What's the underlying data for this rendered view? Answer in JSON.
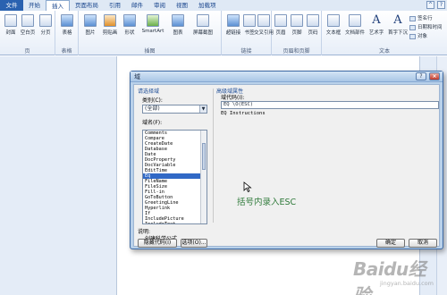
{
  "ribbon_tabs": [
    "文件",
    "开始",
    "插入",
    "页面布局",
    "引用",
    "邮件",
    "审阅",
    "视图",
    "加载项"
  ],
  "window_buttons": [
    "^",
    "?"
  ],
  "ribbon": {
    "pages_group": {
      "label": "页",
      "buttons": [
        "封面",
        "空白页",
        "分页"
      ]
    },
    "table_group": {
      "label": "表格",
      "buttons": [
        "表格"
      ]
    },
    "illustration_group": {
      "label": "插图",
      "buttons": [
        "图片",
        "剪贴画",
        "形状",
        "SmartArt",
        "图表",
        "屏幕截图"
      ]
    },
    "links_group": {
      "label": "链接",
      "buttons": [
        "超链接",
        "书签",
        "交叉引用"
      ]
    },
    "header_group": {
      "label": "页眉和页脚",
      "buttons": [
        "页眉",
        "页脚",
        "页码"
      ]
    },
    "text_group": {
      "label": "文本",
      "buttons": [
        "文本框",
        "文档部件",
        "艺术字",
        "首字下沉"
      ],
      "small_buttons": [
        "签名行",
        "日期和时间",
        "对象"
      ]
    }
  },
  "dialog": {
    "title": "域",
    "help": "?",
    "close": "×",
    "left_section": "请选择域",
    "category_label": "类别(C):",
    "category_value": "(全部)",
    "field_names_label": "域名(F):",
    "field_list": [
      "Comments",
      "Compare",
      "CreateDate",
      "Database",
      "Date",
      "DocProperty",
      "DocVariable",
      "EditTime",
      "Eq",
      "FileName",
      "FileSize",
      "Fill-in",
      "GoToButton",
      "GreetingLine",
      "Hyperlink",
      "If",
      "IncludePicture",
      "IncludeText"
    ],
    "selected_field": "Eq",
    "right_section": "高级域属性",
    "field_code_label": "域代码(I):",
    "field_code_value": "EQ \\O(ESC)",
    "instructions_text": "EQ Instructions",
    "annotation": "括号内录入ESC",
    "description_label": "说明:",
    "description_text": "创建科学公式",
    "hide_codes_button": "隐藏代码(I)",
    "options_button": "选项(O)...",
    "ok_button": "确定",
    "cancel_button": "取消"
  },
  "watermark": {
    "main": "Baidu经验",
    "sub": "jingyan.baidu.com"
  },
  "colors": {
    "file_tab": "#2a62b0",
    "selection": "#3169c6",
    "annotation": "#2f7a3a",
    "section_title": "#1f4e97"
  }
}
